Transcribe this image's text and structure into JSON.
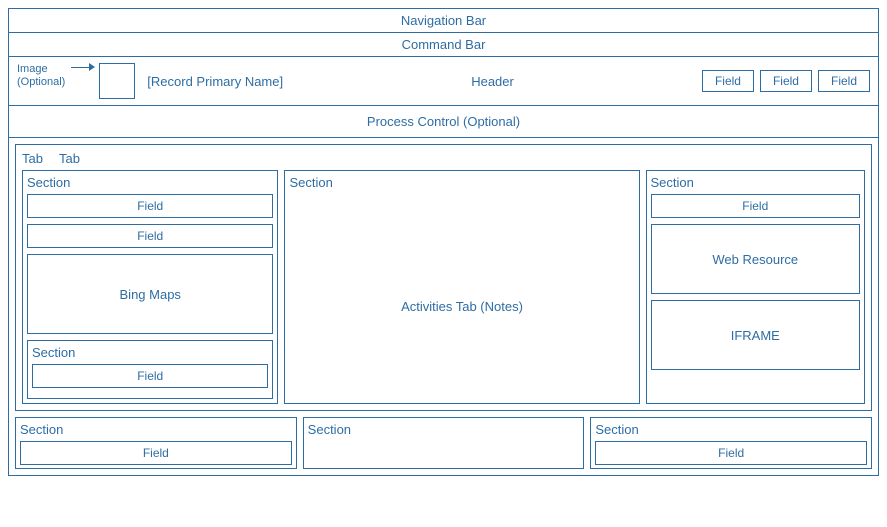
{
  "bars": {
    "nav": "Navigation Bar",
    "cmd": "Command Bar"
  },
  "header": {
    "image_label": "Image\n(Optional)",
    "record_name": "[Record Primary Name]",
    "header_label": "Header",
    "fields": [
      "Field",
      "Field",
      "Field"
    ]
  },
  "process": {
    "label": "Process Control (Optional)"
  },
  "tabs": {
    "labels": [
      "Tab",
      "Tab"
    ],
    "col1": {
      "section_label": "Section",
      "field1": "Field",
      "field2": "Field",
      "bing_maps": "Bing Maps",
      "lower_section": "Section",
      "lower_field": "Field"
    },
    "col2": {
      "section_label": "Section",
      "activities": "Activities Tab (Notes)"
    },
    "col3": {
      "section_label": "Section",
      "field1": "Field",
      "web_resource": "Web Resource",
      "iframe": "IFRAME"
    }
  },
  "bottom": {
    "col1": {
      "section": "Section",
      "field": "Field"
    },
    "col2": {
      "section": "Section"
    },
    "col3": {
      "section": "Section",
      "field": "Field"
    }
  }
}
